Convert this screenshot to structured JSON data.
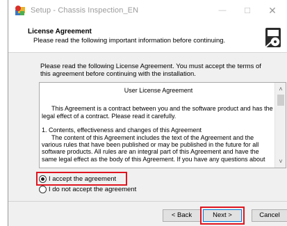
{
  "window": {
    "title": "Setup - Chassis Inspection_EN",
    "controls": {
      "minimize": "—",
      "maximize": "☐",
      "close": "✕"
    }
  },
  "header": {
    "title": "License Agreement",
    "subtitle": "Please read the following important information before continuing."
  },
  "intro_text": "Please read the following License Agreement. You must accept the terms of this agreement before continuing with the installation.",
  "license": {
    "title": "User License Agreement",
    "paragraph1": "This Agreement is a contract between you and the software product and has the legal effect of a contract. Please read it carefully.",
    "section_heading": "1. Contents, effectiveness and changes of this Agreement",
    "section_text": "The content of this Agreement includes the text of the Agreement and the various rules that have been published or may be published in the future for all software products. All rules are an integral part of this Agreement and have the same legal effect as the body of this Agreement. If you have any questions about"
  },
  "options": {
    "accept_label": "I accept the agreement",
    "decline_label": "I do not accept the agreement",
    "selected": "accept"
  },
  "buttons": {
    "back": "< Back",
    "next": "Next >",
    "cancel": "Cancel"
  },
  "icons": {
    "app": "setup-installer-icon",
    "header_logo": "installer-box-logo-icon",
    "scroll_up": "chevron-up-icon",
    "scroll_down": "chevron-down-icon"
  },
  "colors": {
    "highlight": "#e0141e",
    "default_button_border": "#0078d7",
    "title_text": "#9b9b9b"
  }
}
